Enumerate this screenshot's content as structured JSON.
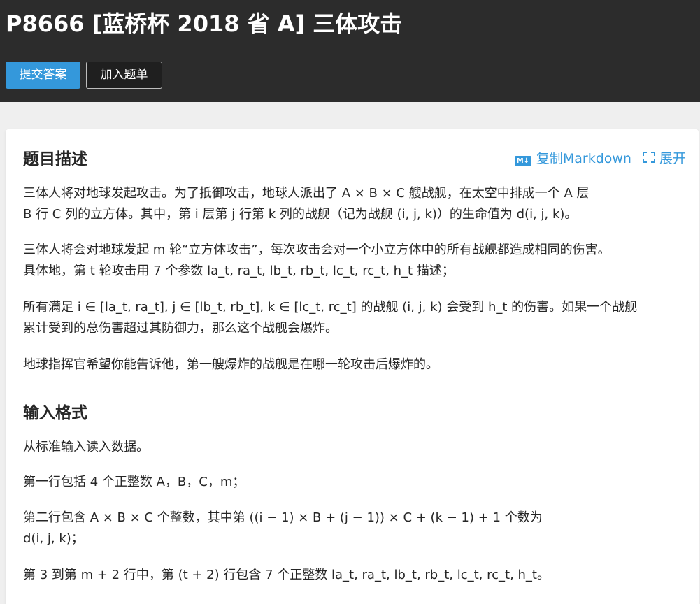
{
  "header": {
    "title": "P8666 [蓝桥杯 2018 省 A] 三体攻击",
    "submit_label": "提交答案",
    "add_label": "加入题单"
  },
  "toolbar": {
    "copy_markdown": "复制Markdown",
    "expand": "展开"
  },
  "sections": {
    "description_title": "题目描述",
    "input_title": "输入格式"
  },
  "description": {
    "p1_line1": "三体人将对地球发起攻击。为了抵御攻击，地球人派出了 A × B × C 艘战舰，在太空中排成一个 A 层",
    "p1_line2": "B 行 C 列的立方体。其中，第 i 层第 j 行第 k 列的战舰（记为战舰 (i, j, k)）的生命值为 d(i, j, k)。",
    "p2_line1": "三体人将会对地球发起 m 轮“立方体攻击”，每次攻击会对一个小立方体中的所有战舰都造成相同的伤害。",
    "p2_line2": "具体地，第 t 轮攻击用 7 个参数 la_t, ra_t, lb_t, rb_t, lc_t, rc_t, h_t 描述；",
    "p3_line1": "所有满足 i ∈ [la_t, ra_t], j ∈ [lb_t, rb_t], k ∈ [lc_t, rc_t] 的战舰 (i, j, k) 会受到 h_t 的伤害。如果一个战舰",
    "p3_line2": "累计受到的总伤害超过其防御力，那么这个战舰会爆炸。",
    "p4": "地球指挥官希望你能告诉他，第一艘爆炸的战舰是在哪一轮攻击后爆炸的。"
  },
  "input_format": {
    "p1": "从标准输入读入数据。",
    "p2": "第一行包括 4 个正整数 A，B，C，m；",
    "p3_line1": "第二行包含 A × B × C 个整数，其中第 ((i − 1) × B + (j − 1)) × C + (k − 1) + 1 个数为",
    "p3_line2": "d(i, j, k)；",
    "p4": "第 3 到第 m + 2 行中，第 (t + 2) 行包含 7 个正整数 la_t, ra_t, lb_t, rb_t, lc_t, rc_t, h_t。"
  },
  "colors": {
    "header_bg": "#2c2c2c",
    "accent": "#3498db",
    "page_bg": "#efefef",
    "card_bg": "#ffffff"
  }
}
